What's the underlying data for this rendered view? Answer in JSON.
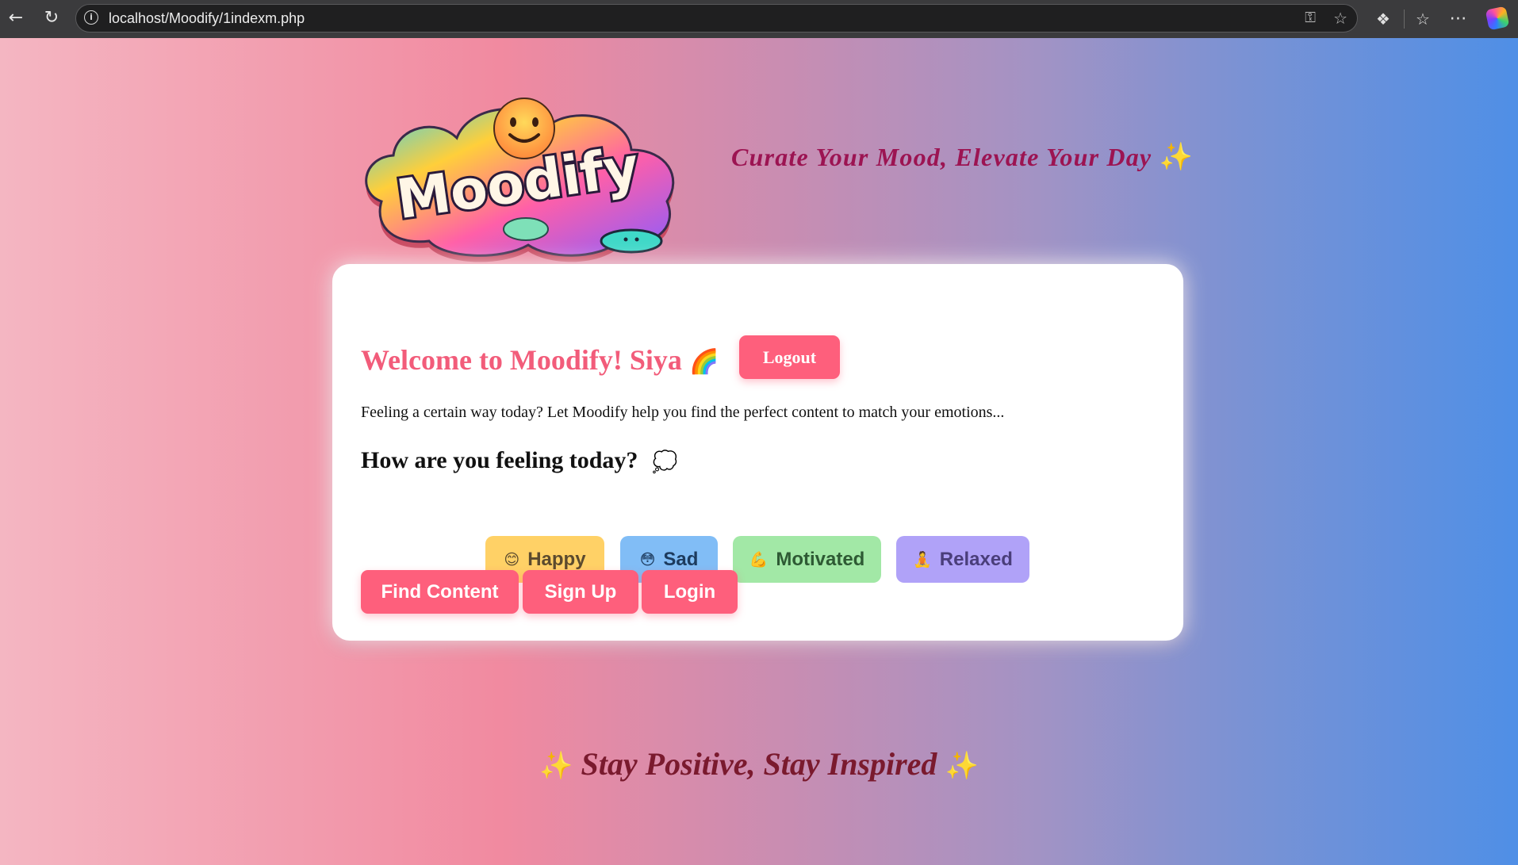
{
  "browser": {
    "url": "localhost/Moodify/1indexm.php",
    "icons": {
      "back": "back-arrow-icon",
      "reload": "reload-icon",
      "site_info": "info-icon",
      "password": "key-icon",
      "favorite": "star-icon",
      "extensions": "extensions-icon",
      "favorites_bar": "favorites-icon",
      "more": "more-icon",
      "copilot": "copilot-icon"
    }
  },
  "header": {
    "logo_text": "Moodify",
    "tagline": "Curate Your Mood, Elevate Your Day",
    "tagline_icon": "✨"
  },
  "card": {
    "welcome": "Welcome to Moodify! Siya",
    "welcome_icon": "🌈",
    "logout_label": "Logout",
    "intro": "Feeling a certain way today? Let Moodify help you find the perfect content to match your emotions...",
    "question": "How are you feeling today?",
    "question_icon": "💭",
    "moods": [
      {
        "emoji": "😊",
        "label": "Happy"
      },
      {
        "emoji": "😳",
        "label": "Sad"
      },
      {
        "emoji": "💪",
        "label": "Motivated"
      },
      {
        "emoji": "🧘",
        "label": "Relaxed"
      }
    ],
    "actions": {
      "find": "Find Content",
      "signup": "Sign Up",
      "login": "Login"
    }
  },
  "footer": {
    "text": "Stay Positive, Stay Inspired",
    "icon": "✨"
  },
  "colors": {
    "accent": "#fe5f7c",
    "welcome": "#f25c7a",
    "tagline": "#9c1452",
    "footer": "#7a1a2e",
    "happy": "#ffd166",
    "sad": "#81bdf6",
    "motivated": "#a2e8a6",
    "relaxed": "#b0a2f8"
  }
}
